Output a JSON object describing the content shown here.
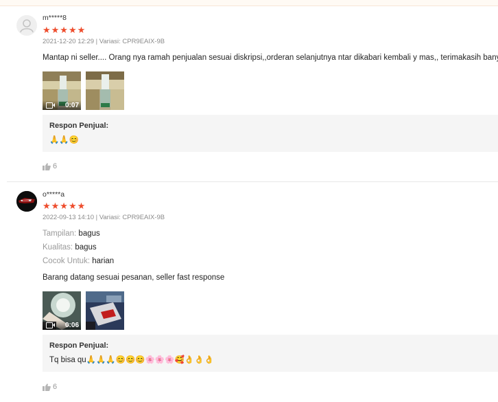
{
  "reviews": [
    {
      "username": "m*****8",
      "stars": "★★★★★",
      "meta": "2021-12-20 12:29 | Variasi: CPR9EAIX-9B",
      "text": "Mantap ni seller.... Orang nya ramah penjualan sesuai diskripsi,,orderan selanjutnya ntar dikabari kembali y mas,, terimakasih banyak",
      "media": [
        {
          "type": "video",
          "duration": "0:07"
        },
        {
          "type": "image"
        }
      ],
      "response": {
        "title": "Respon Penjual:",
        "text": "🙏🙏😊"
      },
      "likes": "6"
    },
    {
      "username": "o*****a",
      "stars": "★★★★★",
      "meta": "2022-09-13 14:10 | Variasi: CPR9EAIX-9B",
      "attributes": [
        {
          "key": "Tampilan:",
          "value": "bagus"
        },
        {
          "key": "Kualitas:",
          "value": "bagus"
        },
        {
          "key": "Cocok Untuk:",
          "value": "harian"
        }
      ],
      "text": "Barang datang sesuai pesanan, seller fast response",
      "media": [
        {
          "type": "video",
          "duration": "0:06"
        },
        {
          "type": "image"
        }
      ],
      "response": {
        "title": "Respon Penjual:",
        "text": "Tq bisa qu🙏🙏🙏😊😊😊🌸🌸🌸🥰👌👌👌"
      },
      "likes": "6"
    }
  ],
  "colors": {
    "star": "#ee4d2d",
    "meta": "#8a8a8a",
    "response_bg": "#f5f5f5"
  }
}
